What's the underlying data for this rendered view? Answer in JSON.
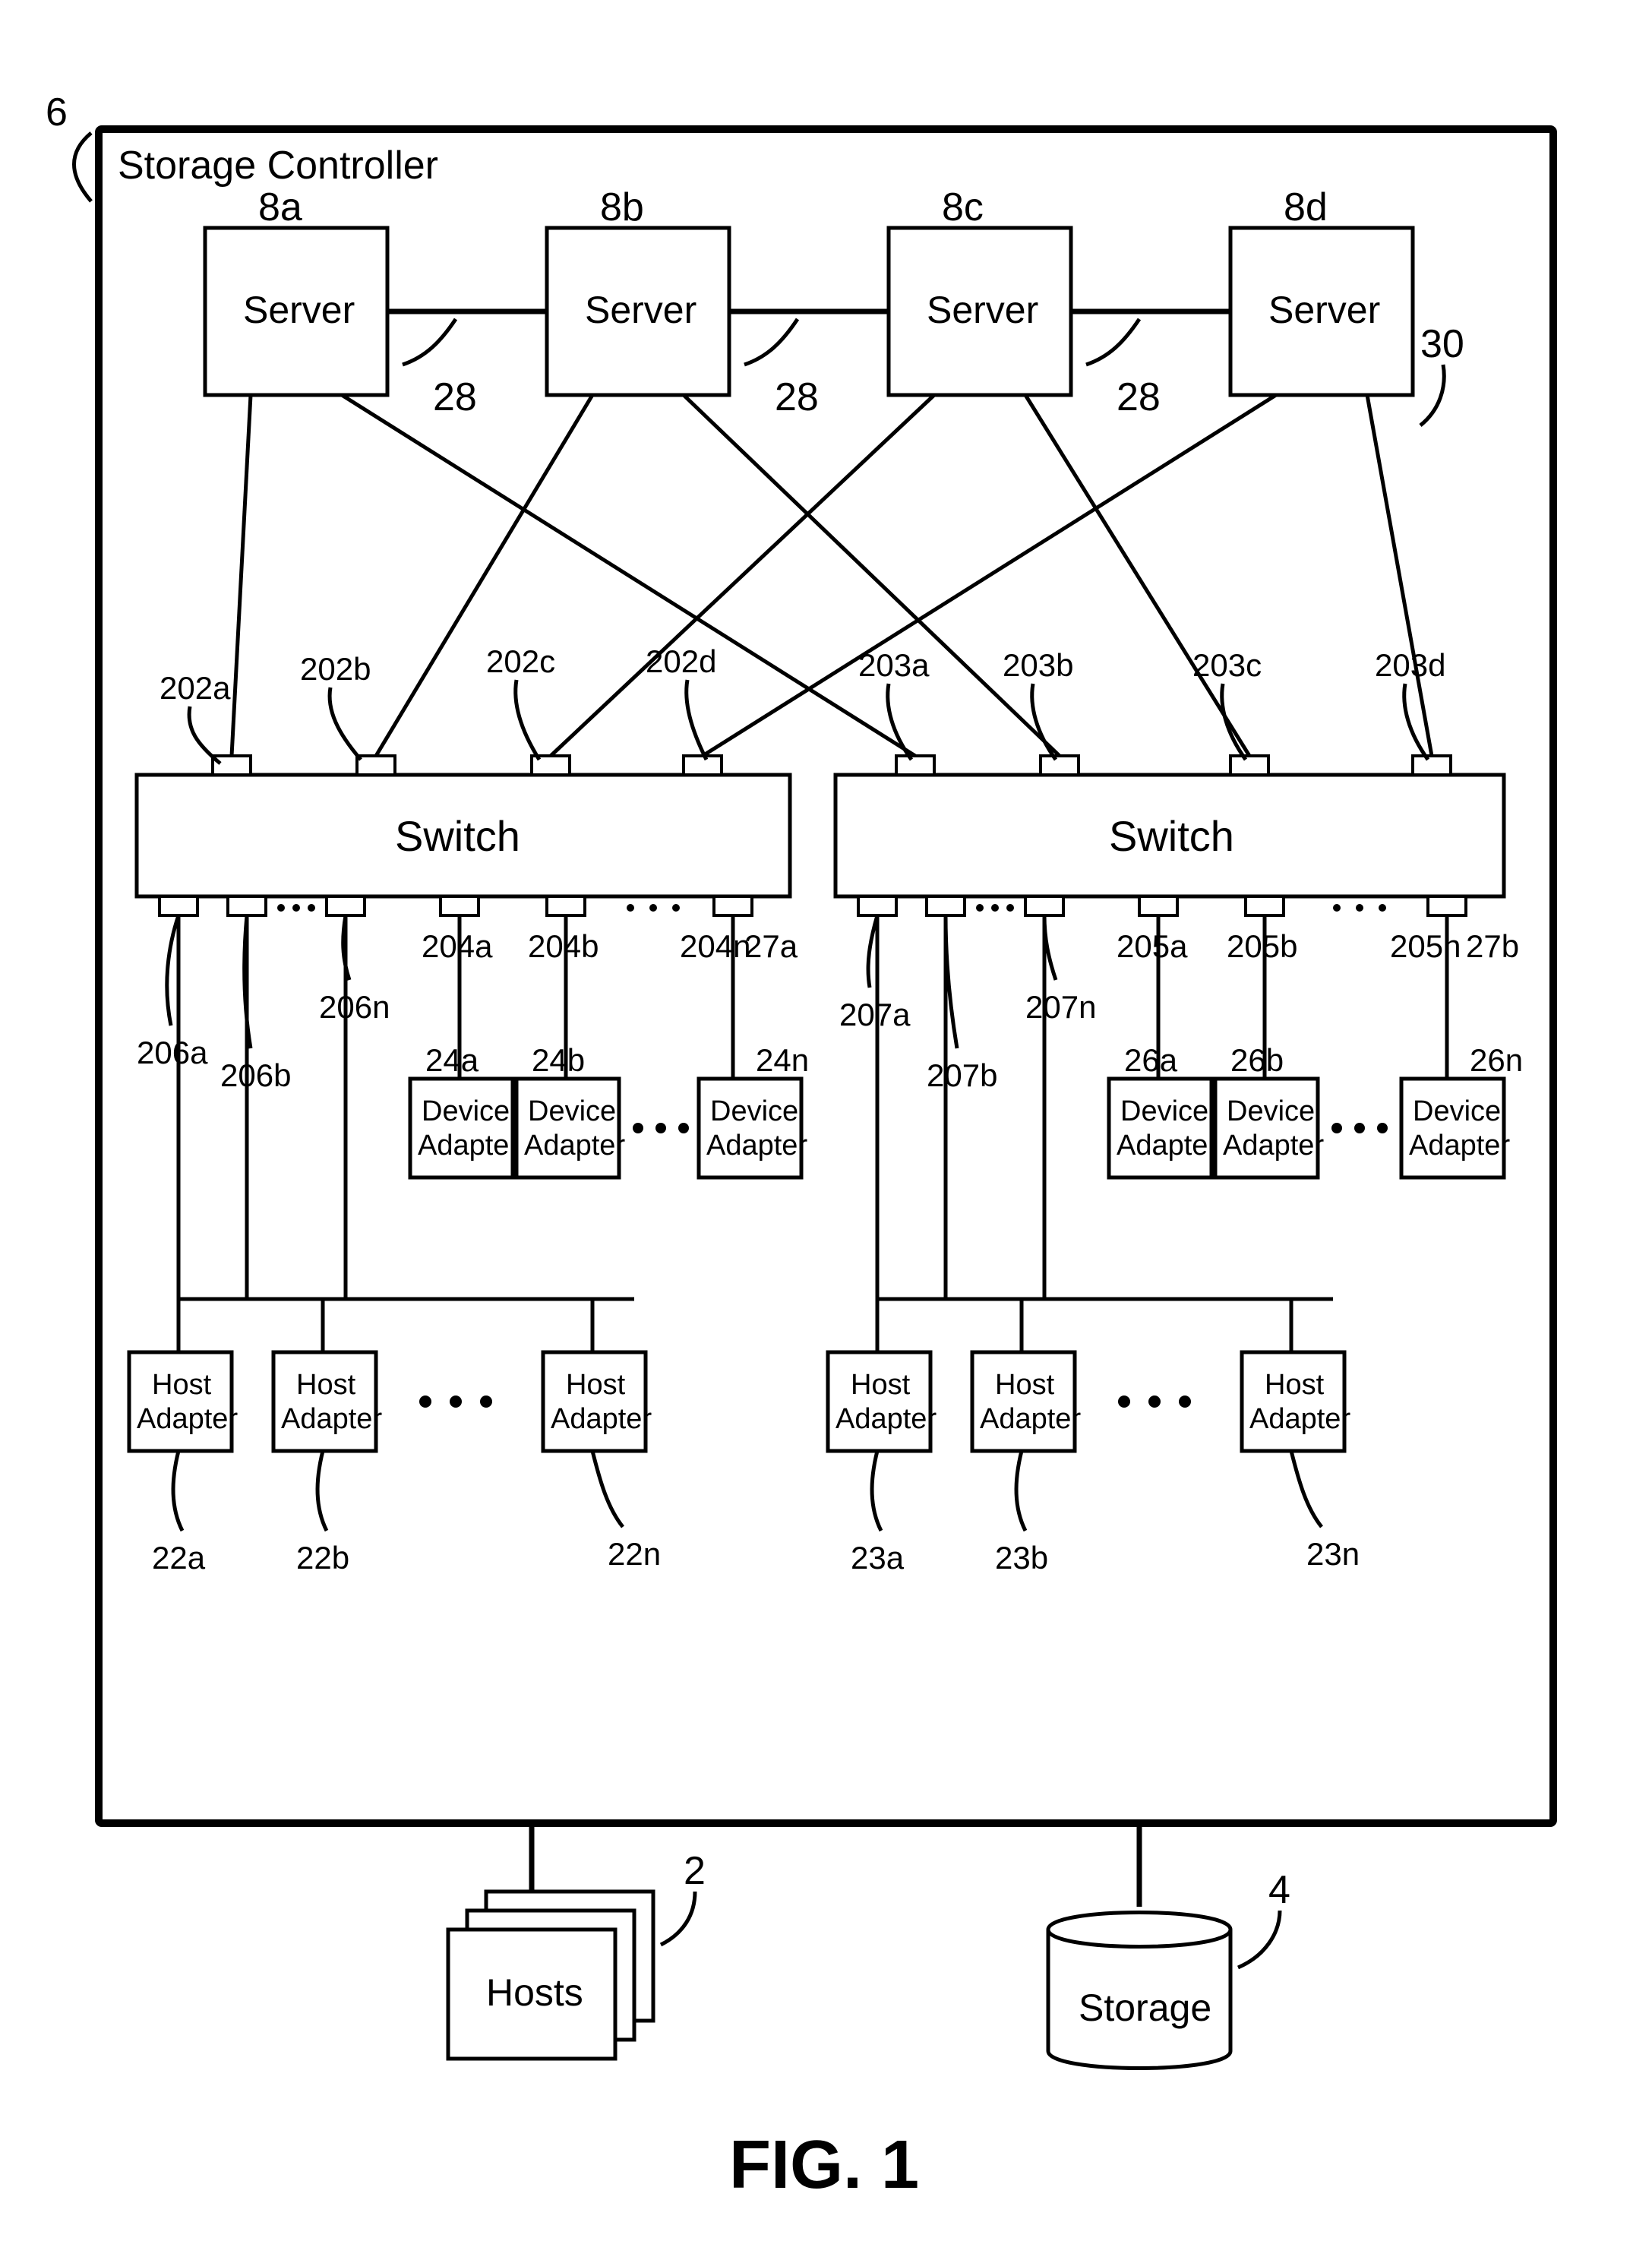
{
  "figure_label": "FIG. 1",
  "container": {
    "label": "Storage Controller",
    "ref": "6"
  },
  "servers": [
    {
      "label": "Server",
      "ref": "8a"
    },
    {
      "label": "Server",
      "ref": "8b"
    },
    {
      "label": "Server",
      "ref": "8c"
    },
    {
      "label": "Server",
      "ref": "8d"
    }
  ],
  "server_links_ref": "28",
  "fabric_ref": "30",
  "switches": [
    {
      "label": "Switch",
      "ref": "27a",
      "top_ports": [
        "202a",
        "202b",
        "202c",
        "202d"
      ],
      "bottom_ports_host": [
        "206a",
        "206b",
        "206n"
      ],
      "bottom_ports_device": [
        "204a",
        "204b",
        "204n"
      ]
    },
    {
      "label": "Switch",
      "ref": "27b",
      "top_ports": [
        "203a",
        "203b",
        "203c",
        "203d"
      ],
      "bottom_ports_host": [
        "207a",
        "207b",
        "207n"
      ],
      "bottom_ports_device": [
        "205a",
        "205b",
        "205n"
      ]
    }
  ],
  "host_adapters": [
    {
      "label1": "Host",
      "label2": "Adapter",
      "ref": "22a"
    },
    {
      "label1": "Host",
      "label2": "Adapter",
      "ref": "22b"
    },
    {
      "label1": "Host",
      "label2": "Adapter",
      "ref": "22n"
    },
    {
      "label1": "Host",
      "label2": "Adapter",
      "ref": "23a"
    },
    {
      "label1": "Host",
      "label2": "Adapter",
      "ref": "23b"
    },
    {
      "label1": "Host",
      "label2": "Adapter",
      "ref": "23n"
    }
  ],
  "device_adapters": [
    {
      "label1": "Device",
      "label2": "Adapter",
      "ref": "24a"
    },
    {
      "label1": "Device",
      "label2": "Adapter",
      "ref": "24b"
    },
    {
      "label1": "Device",
      "label2": "Adapter",
      "ref": "24n"
    },
    {
      "label1": "Device",
      "label2": "Adapter",
      "ref": "26a"
    },
    {
      "label1": "Device",
      "label2": "Adapter",
      "ref": "26b"
    },
    {
      "label1": "Device",
      "label2": "Adapter",
      "ref": "26n"
    }
  ],
  "ext_hosts": {
    "label": "Hosts",
    "ref": "2"
  },
  "ext_storage": {
    "label": "Storage",
    "ref": "4"
  }
}
